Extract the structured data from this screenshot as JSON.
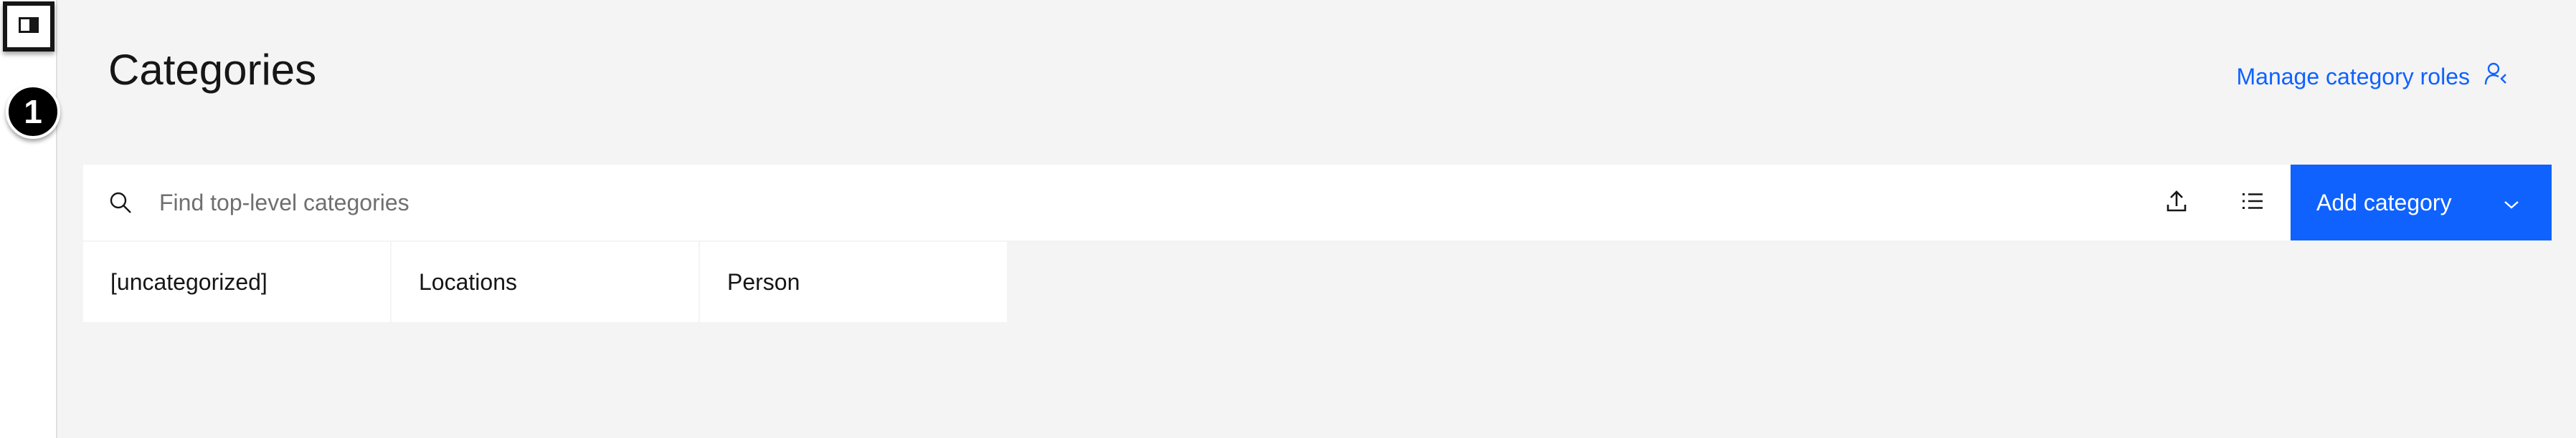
{
  "rail": {
    "step_number": "1"
  },
  "header": {
    "title": "Categories",
    "manage_roles_label": "Manage category roles"
  },
  "toolbar": {
    "search_placeholder": "Find top-level categories",
    "add_category_label": "Add category"
  },
  "categories": [
    {
      "label": "[uncategorized]"
    },
    {
      "label": "Locations"
    },
    {
      "label": "Person"
    }
  ],
  "colors": {
    "accent": "#0f62fe",
    "page_background": "#f4f4f4",
    "surface": "#ffffff",
    "text": "#161616",
    "placeholder": "#6f6f6f"
  },
  "icons": {
    "panel_toggle": "side-panel-icon",
    "manage_roles": "user-settings-icon",
    "search": "search-icon",
    "import": "upload-icon",
    "view": "list-view-icon",
    "add_menu": "chevron-down-icon"
  }
}
